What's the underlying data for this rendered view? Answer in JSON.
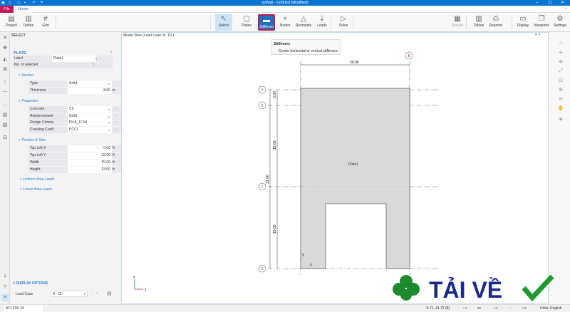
{
  "app": {
    "title": "spWall - Untitled (Modified)",
    "tabs": [
      "File",
      "Home"
    ]
  },
  "ribbon": {
    "buttons": [
      {
        "label": "Project",
        "icon": "project-icon"
      },
      {
        "label": "Define",
        "icon": "define-icon"
      },
      {
        "label": "Grid",
        "icon": "grid-icon"
      },
      {
        "label": "Select",
        "icon": "cursor-icon"
      },
      {
        "label": "Plates",
        "icon": "plate-icon"
      },
      {
        "label": "Stiffeners",
        "icon": "stiffener-icon"
      },
      {
        "label": "Nodes",
        "icon": "node-icon"
      },
      {
        "label": "Restraints",
        "icon": "restraint-icon"
      },
      {
        "label": "Loads",
        "icon": "load-icon"
      },
      {
        "label": "Solve",
        "icon": "solve-icon"
      },
      {
        "label": "Results",
        "icon": "results-icon"
      },
      {
        "label": "Tables",
        "icon": "table-icon"
      },
      {
        "label": "Reporter",
        "icon": "printer-icon"
      },
      {
        "label": "Display",
        "icon": "display-icon"
      },
      {
        "label": "Viewports",
        "icon": "viewports-icon"
      },
      {
        "label": "Settings",
        "icon": "gear-icon"
      }
    ]
  },
  "tooltip": {
    "title": "Stiffeners",
    "text": "Create horizontal or vertical stiffeners"
  },
  "panel": {
    "header": "SELECT",
    "group": "PLATE",
    "general": [
      {
        "k": "Label",
        "v": "Plate1"
      },
      {
        "k": "No. of selected",
        "v": "1"
      }
    ],
    "section_title": "Section",
    "section": [
      {
        "k": "Type",
        "v": "Solid",
        "u": ""
      },
      {
        "k": "Thickness",
        "v": "8.00",
        "u": "in"
      }
    ],
    "properties_title": "Properties",
    "properties": [
      {
        "k": "Concrete",
        "v": "C5"
      },
      {
        "k": "Reinforcement",
        "v": "Gr60"
      },
      {
        "k": "Design Criteria",
        "v": "Plt-8_1C#4"
      },
      {
        "k": "Cracking Coeff.",
        "v": "PCC1"
      }
    ],
    "position_title": "Position & Size",
    "position": [
      {
        "k": "Top Left X",
        "v": "0.00",
        "u": "ft"
      },
      {
        "k": "Top Left Y",
        "v": "33.00",
        "u": "ft"
      },
      {
        "k": "Width",
        "v": "20.00",
        "u": "ft"
      },
      {
        "k": "Height",
        "v": "33.00",
        "u": "ft"
      }
    ],
    "uniform_loads": "Uniform Area Loads",
    "linear_loads": "Linear Area Loads",
    "display_options": "DISPLAY OPTIONS",
    "load_case_label": "Load Case",
    "load_case": "A - DL"
  },
  "view": {
    "title": "Model View (Load Case: A - DL)",
    "plate_label": "Plate1",
    "width_dim": "20.00",
    "dims": [
      "3.00",
      "15.00",
      "33.00",
      "15.00"
    ],
    "grid_v": [
      "B"
    ],
    "grid_h": [
      "3",
      "2",
      "1",
      "0"
    ],
    "axis_x": "x",
    "axis_y": "y"
  },
  "status": {
    "code": "ACI 318-14",
    "coords": "-5.71, 41.72 (ft)",
    "units": "Units: English"
  },
  "logo": {
    "text": "TẢI VỀ"
  },
  "colors": {
    "accent": "#0a74d4",
    "highlight": "#c2185b",
    "plate": "#d9d9d9",
    "grid_label": "#c0392b"
  }
}
